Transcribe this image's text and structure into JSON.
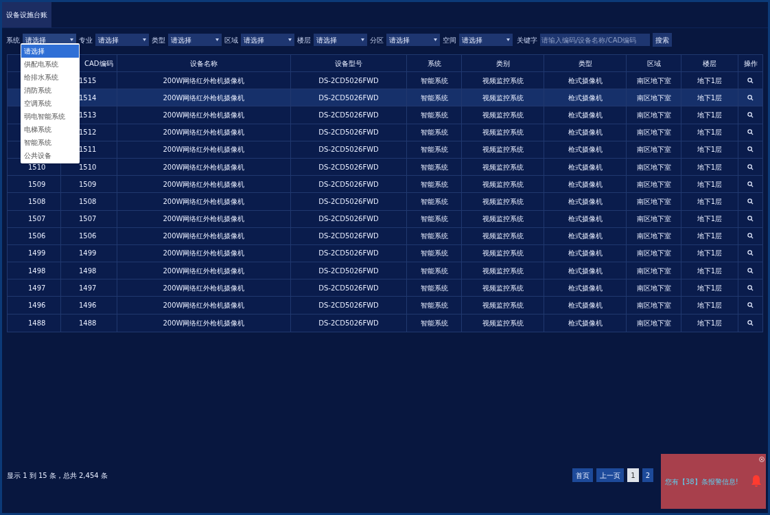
{
  "tab": {
    "label": "设备设施台账",
    "selected": true
  },
  "filters": [
    {
      "label": "系统",
      "value": "请选择",
      "open": true
    },
    {
      "label": "专业",
      "value": "请选择",
      "open": false
    },
    {
      "label": "类型",
      "value": "请选择",
      "open": false
    },
    {
      "label": "区域",
      "value": "请选择",
      "open": false
    },
    {
      "label": "楼层",
      "value": "请选择",
      "open": false
    },
    {
      "label": "分区",
      "value": "请选择",
      "open": false
    },
    {
      "label": "空间",
      "value": "请选择",
      "open": false
    }
  ],
  "keyword": {
    "label": "关键字",
    "placeholder": "请输入编码/设备名称/CAD编码"
  },
  "search_button": "搜索",
  "dropdown_options": [
    {
      "label": "请选择",
      "selected": true
    },
    {
      "label": "供配电系统",
      "selected": false
    },
    {
      "label": "给排水系统",
      "selected": false
    },
    {
      "label": "消防系统",
      "selected": false
    },
    {
      "label": "空调系统",
      "selected": false
    },
    {
      "label": "弱电智能系统",
      "selected": false
    },
    {
      "label": "电梯系统",
      "selected": false
    },
    {
      "label": "智能系统",
      "selected": false
    },
    {
      "label": "公共设备",
      "selected": false
    }
  ],
  "table": {
    "columns": [
      "",
      "CAD编码",
      "设备名称",
      "设备型号",
      "系统",
      "类别",
      "类型",
      "区域",
      "楼层",
      "操作"
    ],
    "rows": [
      {
        "selected": false,
        "cells": [
          "",
          "1515",
          "200W网络红外枪机摄像机",
          "DS-2CD5026FWD",
          "智能系统",
          "视频监控系统",
          "枪式摄像机",
          "南区地下室",
          "地下1层"
        ]
      },
      {
        "selected": true,
        "cells": [
          "",
          "1514",
          "200W网络红外枪机摄像机",
          "DS-2CD5026FWD",
          "智能系统",
          "视频监控系统",
          "枪式摄像机",
          "南区地下室",
          "地下1层"
        ]
      },
      {
        "selected": false,
        "cells": [
          "",
          "1513",
          "200W网络红外枪机摄像机",
          "DS-2CD5026FWD",
          "智能系统",
          "视频监控系统",
          "枪式摄像机",
          "南区地下室",
          "地下1层"
        ]
      },
      {
        "selected": false,
        "cells": [
          "",
          "1512",
          "200W网络红外枪机摄像机",
          "DS-2CD5026FWD",
          "智能系统",
          "视频监控系统",
          "枪式摄像机",
          "南区地下室",
          "地下1层"
        ]
      },
      {
        "selected": false,
        "cells": [
          "",
          "1511",
          "200W网络红外枪机摄像机",
          "DS-2CD5026FWD",
          "智能系统",
          "视频监控系统",
          "枪式摄像机",
          "南区地下室",
          "地下1层"
        ]
      },
      {
        "selected": false,
        "cells": [
          "1510",
          "1510",
          "200W网络红外枪机摄像机",
          "DS-2CD5026FWD",
          "智能系统",
          "视频监控系统",
          "枪式摄像机",
          "南区地下室",
          "地下1层"
        ]
      },
      {
        "selected": false,
        "cells": [
          "1509",
          "1509",
          "200W网络红外枪机摄像机",
          "DS-2CD5026FWD",
          "智能系统",
          "视频监控系统",
          "枪式摄像机",
          "南区地下室",
          "地下1层"
        ]
      },
      {
        "selected": false,
        "cells": [
          "1508",
          "1508",
          "200W网络红外枪机摄像机",
          "DS-2CD5026FWD",
          "智能系统",
          "视频监控系统",
          "枪式摄像机",
          "南区地下室",
          "地下1层"
        ]
      },
      {
        "selected": false,
        "cells": [
          "1507",
          "1507",
          "200W网络红外枪机摄像机",
          "DS-2CD5026FWD",
          "智能系统",
          "视频监控系统",
          "枪式摄像机",
          "南区地下室",
          "地下1层"
        ]
      },
      {
        "selected": false,
        "cells": [
          "1506",
          "1506",
          "200W网络红外枪机摄像机",
          "DS-2CD5026FWD",
          "智能系统",
          "视频监控系统",
          "枪式摄像机",
          "南区地下室",
          "地下1层"
        ]
      },
      {
        "selected": false,
        "cells": [
          "1499",
          "1499",
          "200W网络红外枪机摄像机",
          "DS-2CD5026FWD",
          "智能系统",
          "视频监控系统",
          "枪式摄像机",
          "南区地下室",
          "地下1层"
        ]
      },
      {
        "selected": false,
        "cells": [
          "1498",
          "1498",
          "200W网络红外枪机摄像机",
          "DS-2CD5026FWD",
          "智能系统",
          "视频监控系统",
          "枪式摄像机",
          "南区地下室",
          "地下1层"
        ]
      },
      {
        "selected": false,
        "cells": [
          "1497",
          "1497",
          "200W网络红外枪机摄像机",
          "DS-2CD5026FWD",
          "智能系统",
          "视频监控系统",
          "枪式摄像机",
          "南区地下室",
          "地下1层"
        ]
      },
      {
        "selected": false,
        "cells": [
          "1496",
          "1496",
          "200W网络红外枪机摄像机",
          "DS-2CD5026FWD",
          "智能系统",
          "视频监控系统",
          "枪式摄像机",
          "南区地下室",
          "地下1层"
        ]
      },
      {
        "selected": false,
        "cells": [
          "1488",
          "1488",
          "200W网络红外枪机摄像机",
          "DS-2CD5026FWD",
          "智能系统",
          "视频监控系统",
          "枪式摄像机",
          "南区地下室",
          "地下1层"
        ]
      }
    ]
  },
  "footer_info": "显示 1 到 15 条，总共 2,454 条",
  "pagination": [
    {
      "label": "首页",
      "selected": false
    },
    {
      "label": "上一页",
      "selected": false
    },
    {
      "label": "1",
      "selected": true
    },
    {
      "label": "2",
      "selected": false
    }
  ],
  "alert": {
    "message": "您有【38】条报警信息!"
  }
}
